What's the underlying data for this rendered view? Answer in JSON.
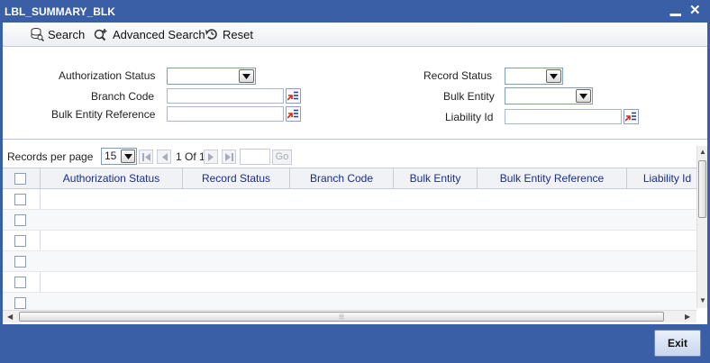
{
  "window": {
    "title": "LBL_SUMMARY_BLK",
    "minimize": "▁",
    "close": "✕"
  },
  "toolbar": {
    "search_label": "Search",
    "advanced_search_label": "Advanced Search",
    "reset_label": "Reset"
  },
  "form": {
    "authorization_status_label": "Authorization Status",
    "branch_code_label": "Branch Code",
    "bulk_entity_reference_label": "Bulk Entity Reference",
    "record_status_label": "Record Status",
    "bulk_entity_label": "Bulk Entity",
    "liability_id_label": "Liability Id"
  },
  "pager": {
    "records_per_page_label": "Records per page",
    "records_per_page_value": "15",
    "page_info": "1 Of 1",
    "go_label": "Go"
  },
  "grid": {
    "columns": [
      "Authorization Status",
      "Record Status",
      "Branch Code",
      "Bulk Entity",
      "Bulk Entity Reference",
      "Liability Id"
    ]
  },
  "footer": {
    "exit_label": "Exit"
  },
  "colors": {
    "frame": "#3a5fa6",
    "header_text": "#1a2d8a"
  }
}
